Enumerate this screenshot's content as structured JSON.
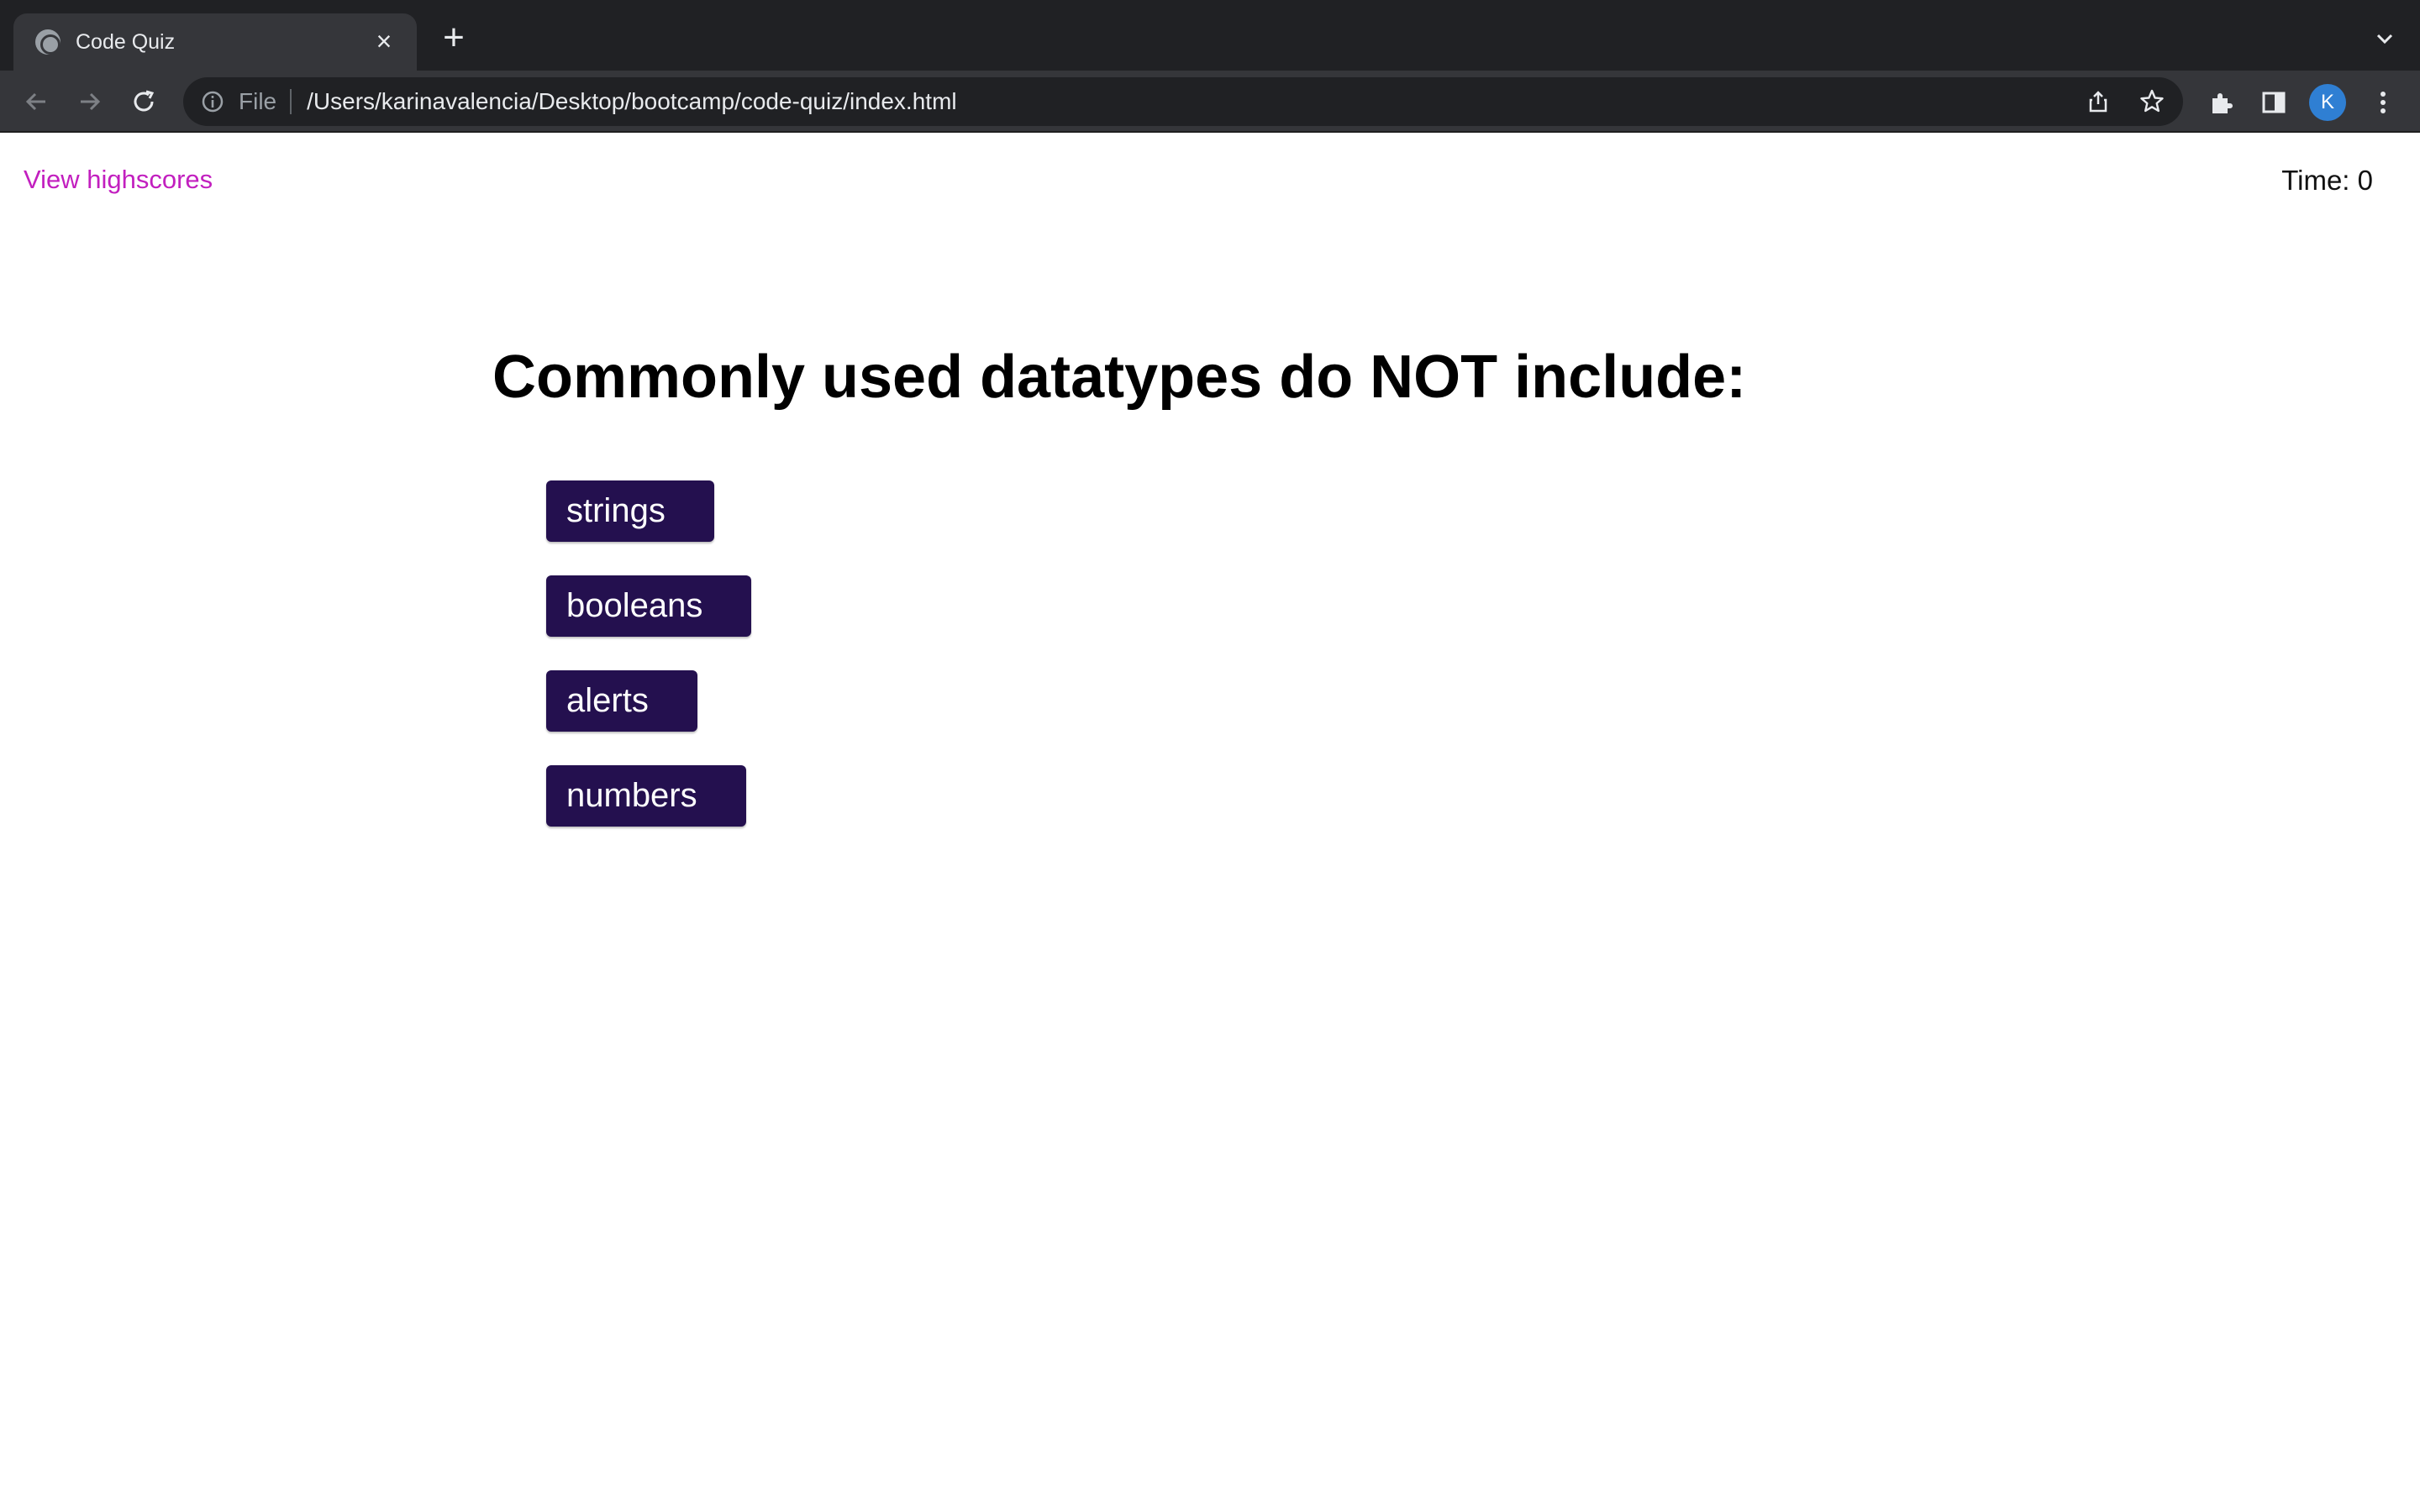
{
  "browser": {
    "tab_title": "Code Quiz",
    "address_scheme": "File",
    "address_url": "/Users/karinavalencia/Desktop/bootcamp/code-quiz/index.html",
    "profile_initial": "K"
  },
  "header": {
    "highscores_link": "View highscores",
    "timer_text": "Time: 0"
  },
  "quiz": {
    "question": "Commonly used datatypes do NOT include:",
    "answers": [
      "strings",
      "booleans",
      "alerts",
      "numbers"
    ]
  },
  "colors": {
    "link": "#c21fbf",
    "answer_button_bg": "#24104f",
    "answer_button_text": "#ffffff"
  }
}
